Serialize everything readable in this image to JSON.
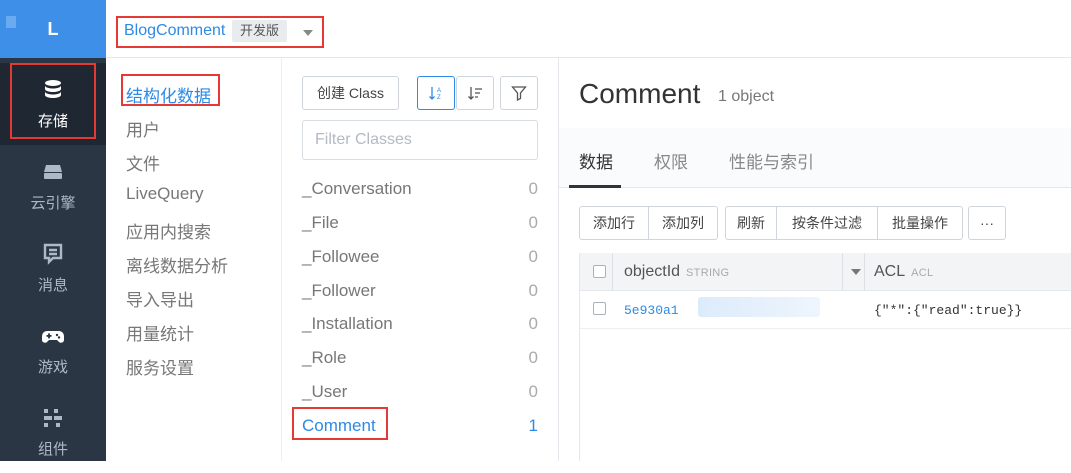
{
  "sidebar": {
    "logo_letter": "L",
    "items": [
      {
        "label": "存储",
        "icon": "database-icon"
      },
      {
        "label": "云引擎",
        "icon": "cloud-engine-icon"
      },
      {
        "label": "消息",
        "icon": "message-icon"
      },
      {
        "label": "游戏",
        "icon": "gamepad-icon"
      },
      {
        "label": "组件",
        "icon": "components-icon"
      }
    ],
    "active_item": "存储"
  },
  "header": {
    "app_name": "BlogComment",
    "env_badge": "开发版"
  },
  "subnav": {
    "items": [
      "结构化数据",
      "用户",
      "文件",
      "LiveQuery",
      "应用内搜索",
      "离线数据分析",
      "导入导出",
      "用量统计",
      "服务设置"
    ],
    "active": "结构化数据"
  },
  "classes": {
    "create_button": "创建 Class",
    "filter_placeholder": "Filter Classes",
    "items": [
      {
        "name": "_Conversation",
        "count": "0"
      },
      {
        "name": "_File",
        "count": "0"
      },
      {
        "name": "_Followee",
        "count": "0"
      },
      {
        "name": "_Follower",
        "count": "0"
      },
      {
        "name": "_Installation",
        "count": "0"
      },
      {
        "name": "_Role",
        "count": "0"
      },
      {
        "name": "_User",
        "count": "0"
      },
      {
        "name": "Comment",
        "count": "1"
      }
    ],
    "active": "Comment"
  },
  "main": {
    "title": "Comment",
    "object_count": "1 object",
    "tabs": [
      "数据",
      "权限",
      "性能与索引"
    ],
    "active_tab": "数据",
    "toolbar": [
      "添加行",
      "添加列",
      "刷新",
      "按条件过滤",
      "批量操作",
      "···"
    ],
    "table": {
      "columns": [
        {
          "name": "objectId",
          "type": "STRING"
        },
        {
          "name": "ACL",
          "type": "ACL"
        }
      ],
      "rows": [
        {
          "objectId": "5e930a1",
          "acl": "{\"*\":{\"read\":true}}"
        }
      ]
    }
  },
  "colors": {
    "accent": "#2d8ae6",
    "sidebar_bg": "#2b3645",
    "logo_bg": "#3d8fe8",
    "highlight_outline": "#e53935"
  }
}
